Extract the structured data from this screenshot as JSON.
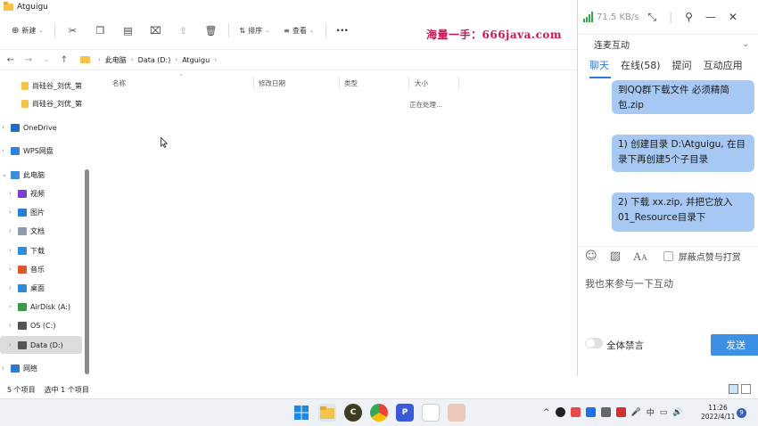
{
  "explorer": {
    "title": "Atguigu",
    "toolbar": {
      "new_label": "新建",
      "sort_label": "排序",
      "view_label": "查看",
      "more_label": "···"
    },
    "address": {
      "crumbs": [
        "此电脑",
        "Data (D:)",
        "Atguigu"
      ]
    },
    "sidebar": [
      {
        "label": "尚硅谷_刘优_第",
        "expandable": false,
        "icon": "folder-icon",
        "color": "#f5c34b"
      },
      {
        "label": "尚硅谷_刘优_第",
        "expandable": false,
        "icon": "folder-icon",
        "color": "#f5c34b"
      },
      {
        "label": "OneDrive",
        "expandable": true,
        "icon": "cloud-icon",
        "color": "#1c6fc9"
      },
      {
        "label": "WPS网盘",
        "expandable": true,
        "icon": "cloud-icon",
        "color": "#2a82e4"
      },
      {
        "label": "此电脑",
        "expandable": true,
        "expanded": true,
        "icon": "computer-icon",
        "color": "#3a8fd9"
      },
      {
        "label": "视频",
        "expandable": true,
        "icon": "video-icon",
        "color": "#7b3fd6"
      },
      {
        "label": "图片",
        "expandable": true,
        "icon": "picture-icon",
        "color": "#2c7bd6"
      },
      {
        "label": "文档",
        "expandable": true,
        "icon": "document-icon",
        "color": "#8b9bb0"
      },
      {
        "label": "下载",
        "expandable": true,
        "icon": "download-icon",
        "color": "#2b8de0"
      },
      {
        "label": "音乐",
        "expandable": true,
        "icon": "music-icon",
        "color": "#e0562b"
      },
      {
        "label": "桌面",
        "expandable": true,
        "icon": "desktop-icon",
        "color": "#2a8ad8"
      },
      {
        "label": "AirDisk (A:)",
        "expandable": true,
        "icon": "drive-icon",
        "color": "#3a9a4a"
      },
      {
        "label": "OS (C:)",
        "expandable": true,
        "icon": "drive-icon",
        "color": "#555555"
      },
      {
        "label": "Data (D:)",
        "expandable": true,
        "selected": true,
        "icon": "drive-icon",
        "color": "#555555"
      },
      {
        "label": "网络",
        "expandable": true,
        "icon": "network-icon",
        "color": "#2a7bd0"
      }
    ],
    "columns": {
      "name": "名称",
      "modified": "修改日期",
      "type": "类型",
      "size": "大小"
    },
    "processing_text": "正在处理...",
    "status": {
      "item_count": "5 个项目",
      "selected": "选中 1 个项目"
    }
  },
  "watermark": "海量一手：666java.com",
  "chat": {
    "speed": "71.5 KB/s",
    "header_title": "连麦互动",
    "tabs": [
      "聊天",
      "在线(58)",
      "提问",
      "互动应用"
    ],
    "messages": [
      "到QQ群下载文件 必须精简包.zip",
      "1) 创建目录 D:\\Atguigu, 在目录下再创建5个子目录",
      "2) 下载 xx.zip, 并把它放入01_Resource目录下"
    ],
    "block_label": "屏蔽点赞与打赏",
    "input_placeholder": "我也来参与一下互动",
    "mute_all_label": "全体禁言",
    "send_label": "发送"
  },
  "taskbar": {
    "time": "11:26",
    "date": "2022/4/11",
    "notifications": "9"
  }
}
